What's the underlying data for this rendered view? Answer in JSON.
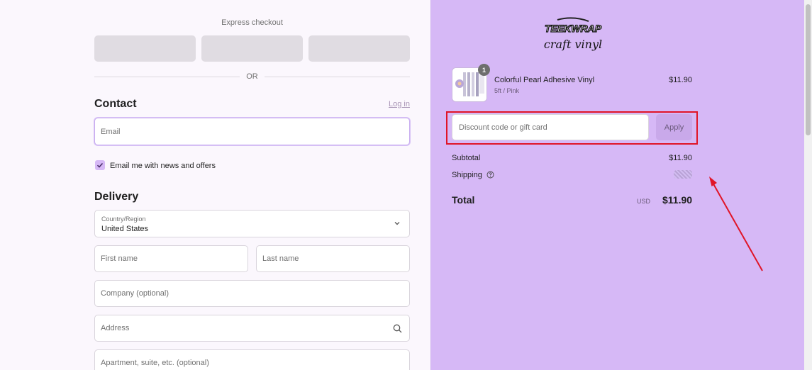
{
  "express_checkout": {
    "title": "Express checkout",
    "or_label": "OR"
  },
  "contact": {
    "title": "Contact",
    "login_label": "Log in",
    "email_placeholder": "Email",
    "newsletter_label": "Email me with news and offers",
    "newsletter_checked": true
  },
  "delivery": {
    "title": "Delivery",
    "country_label": "Country/Region",
    "country_value": "United States",
    "first_name_placeholder": "First name",
    "last_name_placeholder": "Last name",
    "company_placeholder": "Company (optional)",
    "address_placeholder": "Address",
    "apartment_placeholder": "Apartment, suite, etc. (optional)"
  },
  "store": {
    "logo_line1": "TEEKWRAP",
    "logo_line2": "craft vinyl"
  },
  "order": {
    "item": {
      "quantity": "1",
      "name": "Colorful Pearl Adhesive Vinyl",
      "variant": "5ft / Pink",
      "price": "$11.90"
    },
    "discount_placeholder": "Discount code or gift card",
    "apply_label": "Apply",
    "subtotal_label": "Subtotal",
    "subtotal_value": "$11.90",
    "shipping_label": "Shipping",
    "total_label": "Total",
    "total_currency": "USD",
    "total_value": "$11.90"
  },
  "colors": {
    "accent": "#d6b8f6",
    "highlight_box": "#e01528",
    "annotation_arrow": "#e01528"
  },
  "icons": [
    "chevron-down-icon",
    "search-icon",
    "check-icon",
    "help-circle-icon",
    "arrow-annotation"
  ]
}
